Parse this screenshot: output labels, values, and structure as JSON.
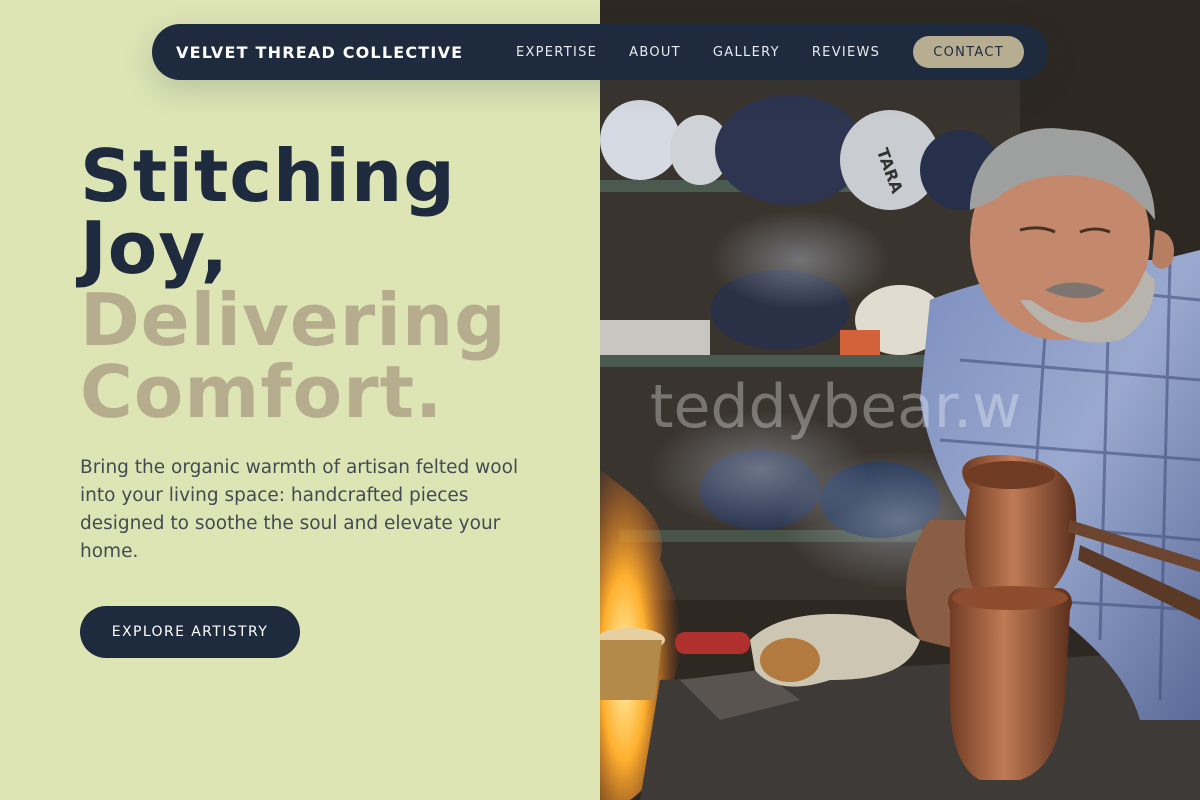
{
  "nav": {
    "brand": "VELVET THREAD COLLECTIVE",
    "links": [
      "EXPERTISE",
      "ABOUT",
      "GALLERY",
      "REVIEWS"
    ],
    "contact": "CONTACT"
  },
  "hero": {
    "line1": "Stitching",
    "line2": "Joy,",
    "line3": "Delivering",
    "line4": "Comfort.",
    "lead": "Bring the organic warmth of artisan felted wool into your living space: handcrafted pieces designed to soothe the soul and elevate your home.",
    "cta": "EXPLORE ARTISTRY"
  },
  "photo": {
    "watermark": "teddybear.w",
    "sack_text": "TARA"
  },
  "colors": {
    "background": "#dde5b5",
    "navy": "#1e2a3e",
    "accent_tan": "#b5ad8e",
    "button_tan": "#b7ad91",
    "body_text": "#444a52"
  },
  "icons": []
}
